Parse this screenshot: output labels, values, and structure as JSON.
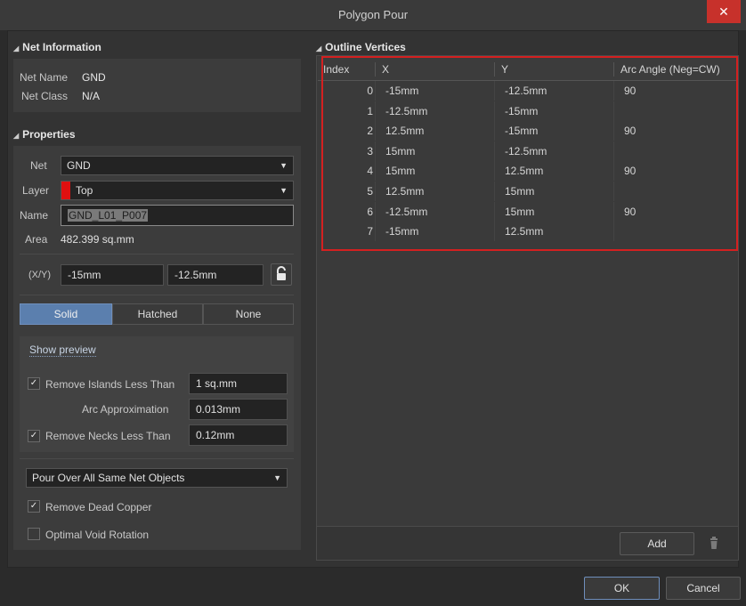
{
  "window": {
    "title": "Polygon Pour",
    "close_glyph": "✕"
  },
  "net_info": {
    "section_title": "Net Information",
    "net_name_label": "Net Name",
    "net_name": "GND",
    "net_class_label": "Net Class",
    "net_class": "N/A"
  },
  "properties": {
    "section_title": "Properties",
    "net_label": "Net",
    "net_value": "GND",
    "layer_label": "Layer",
    "layer_value": "Top",
    "layer_color": "#e01010",
    "name_label": "Name",
    "name_value": "GND_L01_P007",
    "area_label": "Area",
    "area_value": "482.399 sq.mm",
    "xy_label": "(X/Y)",
    "x_value": "-15mm",
    "y_value": "-12.5mm",
    "fill_modes": [
      "Solid",
      "Hatched",
      "None"
    ],
    "selected_fill_mode": "Solid",
    "show_preview": "Show preview",
    "remove_islands_label": "Remove Islands Less Than",
    "remove_islands_checked": true,
    "remove_islands_value": "1 sq.mm",
    "arc_approx_label": "Arc Approximation",
    "arc_approx_value": "0.013mm",
    "remove_necks_label": "Remove Necks Less Than",
    "remove_necks_checked": true,
    "remove_necks_value": "0.12mm",
    "pour_over": "Pour Over All Same Net Objects",
    "remove_dead_copper_label": "Remove Dead Copper",
    "remove_dead_copper_checked": true,
    "optimal_void_label": "Optimal Void Rotation",
    "optimal_void_checked": false
  },
  "outline": {
    "section_title": "Outline Vertices",
    "columns": [
      "Index",
      "X",
      "Y",
      "Arc Angle (Neg=CW)"
    ],
    "rows": [
      {
        "index": "0",
        "x": "-15mm",
        "y": "-12.5mm",
        "arc": "90"
      },
      {
        "index": "1",
        "x": "-12.5mm",
        "y": "-15mm",
        "arc": ""
      },
      {
        "index": "2",
        "x": "12.5mm",
        "y": "-15mm",
        "arc": "90"
      },
      {
        "index": "3",
        "x": "15mm",
        "y": "-12.5mm",
        "arc": ""
      },
      {
        "index": "4",
        "x": "15mm",
        "y": "12.5mm",
        "arc": "90"
      },
      {
        "index": "5",
        "x": "12.5mm",
        "y": "15mm",
        "arc": ""
      },
      {
        "index": "6",
        "x": "-12.5mm",
        "y": "15mm",
        "arc": "90"
      },
      {
        "index": "7",
        "x": "-15mm",
        "y": "12.5mm",
        "arc": ""
      }
    ],
    "add_label": "Add",
    "highlight_color": "#d42020"
  },
  "footer": {
    "ok_label": "OK",
    "cancel_label": "Cancel"
  },
  "icons": {
    "lock": "lock-icon",
    "trash": "trash-icon",
    "check": "✓",
    "caret": "▼",
    "triangle": "◢"
  }
}
